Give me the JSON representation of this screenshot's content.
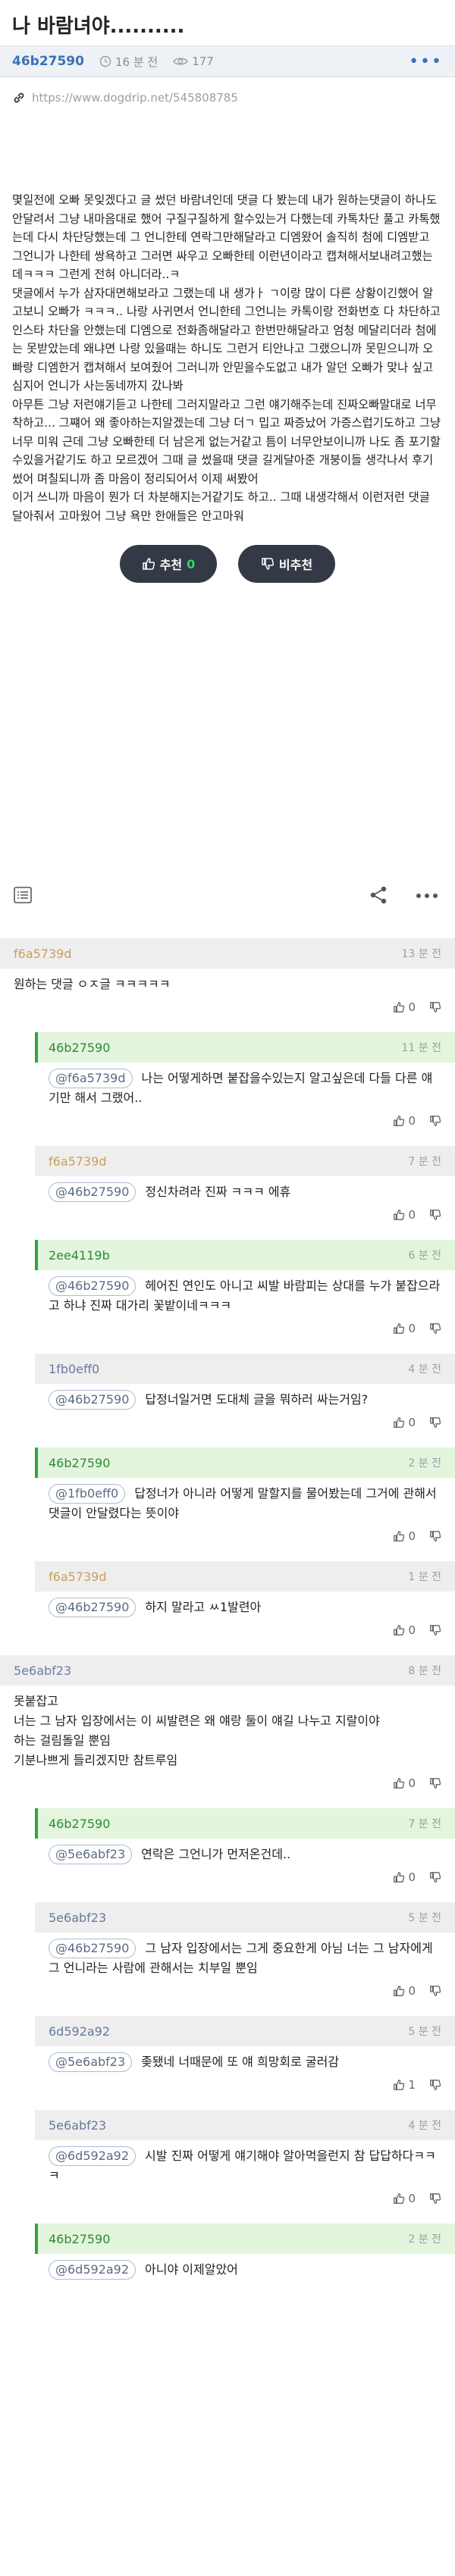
{
  "post": {
    "title": "나 바람녀야..........",
    "author": "46b27590",
    "time": "16 분 전",
    "views": "177",
    "url": "https://www.dogdrip.net/545808785",
    "paragraphs": [
      "몇일전에 오빠 못잊겠다고 글 썼던 바람녀인데 댓글 다 봤는데 내가 원하는댓글이 하나도 안달려서 그냥 내마음대로 했어 구질구질하게 할수있는거 다했는데 카톡차단 풀고 카톡했는데 다시 차단당했는데 그 언니한테 연락그만해달라고 디엠왔어 솔직히 첨에 디엠받고 그언니가 나한테 쌍욕하고 그러면 싸우고 오빠한테 이런년이라고 캡쳐해서보내려고했는데ㅋㅋㅋ 그런게 전혀 아니더라..ㅋ",
      "댓글에서 누가 삼자대면해보라고 그랬는데 내 생가ㅏ ㄱ이랑 많이 다른 상황이긴했어 알고보니 오빠가 ㅋㅋㅋ.. 나랑 사귀면서 언니한테 그언니는 카톡이랑 전화번호 다 차단하고 인스타 차단을 안했는데 디엠으로 전화좀해달라고 한번만해달라고 엄청 메달리더라 첨에는 못받았는데 왜냐면 나랑 있을때는 하니도 그런거 티안나고 그랬으니까 못믿으니까 오빠랑 디엠한거 캡쳐해서 보여줬어 그러니까 안믿을수도없고 내가 알던 오빠가 맞나 싶고",
      "심지어 언니가 사는동네까지 갔나봐",
      "아무튼 그냥 저런얘기듣고 나한테 그러지말라고 그런 얘기해주는데 진짜오빠말대로 너무 착하고... 그쨰어 왜 좋아하는지알겠는데 그냥 더ㄱ 밉고 짜증났어 가증스럽기도하고 그냥 너무 미워 근데 그냥 오빠한테 더 남은게 없는거같고 틈이 너무안보이니까 나도 좀 포기할 수있을거같기도 하고 모르겠어 그때 글 썼을때 댓글 길게달아준 개붕이들 생각나서 후기썼어 며칠되니까 좀 마음이 정리되어서 이제 써봤어",
      "이거 쓰니까 마음이 뭔가 더 차분해지는거같기도 하고.. 그때 내생각해서 이런저런 댓글 달아줘서 고마웠어 그냥 욕만 한애들은 안고마워"
    ],
    "upvote_label": "추천",
    "upvote_count": "0",
    "downvote_label": "비추천"
  },
  "icons": {
    "clock": "clock-icon",
    "eye": "eye-icon",
    "link": "link-icon",
    "list": "list-icon",
    "share": "share-icon",
    "more": "more-icon",
    "thumbs_up": "thumbs-up-icon",
    "thumbs_down": "thumbs-down-icon"
  },
  "comments": [
    {
      "author": "f6a5739d",
      "time": "13 분 전",
      "mention": "",
      "text": "원하는 댓글 ㅇㅈ글 ㅋㅋㅋㅋㅋ",
      "likes": "0",
      "depth": 0,
      "style": "orange"
    },
    {
      "author": "46b27590",
      "time": "11 분 전",
      "mention": "@f6a5739d",
      "text": "나는 어떻게하면 붙잡을수있는지 알고싶은데 다들 다른 얘기만 해서 그랬어..",
      "likes": "0",
      "depth": 1,
      "style": "green"
    },
    {
      "author": "f6a5739d",
      "time": "7 분 전",
      "mention": "@46b27590",
      "text": "정신차려라 진짜 ㅋㅋㅋ 에휴",
      "likes": "0",
      "depth": 1,
      "style": "orange"
    },
    {
      "author": "2ee4119b",
      "time": "6 분 전",
      "mention": "@46b27590",
      "text": "헤어진 연인도 아니고 씨발 바람피는 상대를 누가 붙잡으라고 하냐 진짜 대가리 꽃밭이네ㅋㅋㅋ",
      "likes": "0",
      "depth": 1,
      "style": "green"
    },
    {
      "author": "1fb0eff0",
      "time": "4 분 전",
      "mention": "@46b27590",
      "text": "답정너일거면 도대체 글을 뭐하러 싸는거임?",
      "likes": "0",
      "depth": 1,
      "style": "grey"
    },
    {
      "author": "46b27590",
      "time": "2 분 전",
      "mention": "@1fb0eff0",
      "text": "답정너가 아니라 어떻게 말할지를 물어봤는데 그거에 관해서 댓글이 안달렸다는 뜻이야",
      "likes": "0",
      "depth": 1,
      "style": "green"
    },
    {
      "author": "f6a5739d",
      "time": "1 분 전",
      "mention": "@46b27590",
      "text": "하지 말라고 ㅆ1발련아",
      "likes": "0",
      "depth": 1,
      "style": "orange"
    },
    {
      "author": "5e6abf23",
      "time": "8 분 전",
      "mention": "",
      "text": "못붙잡고\n너는 그 남자 입장에서는 이 씨발련은 왜 얘랑 둘이 얘길 나누고 지랄이야\n하는 걸림돌일 뿐임\n기분나쁘게 들리겠지만 참트루임",
      "likes": "0",
      "depth": 0,
      "style": "grey"
    },
    {
      "author": "46b27590",
      "time": "7 분 전",
      "mention": "@5e6abf23",
      "text": "연락은 그언니가 먼저온건데..",
      "likes": "0",
      "depth": 1,
      "style": "green"
    },
    {
      "author": "5e6abf23",
      "time": "5 분 전",
      "mention": "@46b27590",
      "text": "그 남자 입장에서는 그게 중요한게 아님 너는 그 남자에게 그 언니라는 사람에 관해서는 치부일 뿐임",
      "likes": "0",
      "depth": 1,
      "style": "grey"
    },
    {
      "author": "6d592a92",
      "time": "5 분 전",
      "mention": "@5e6abf23",
      "text": "좆됐네 너때문에 또 얘 희망회로 굴러감",
      "likes": "1",
      "depth": 1,
      "style": "grey"
    },
    {
      "author": "5e6abf23",
      "time": "4 분 전",
      "mention": "@6d592a92",
      "text": "시발 진짜 어떻게 얘기해야 알아먹을런지 참 답답하다ㅋㅋㅋ",
      "likes": "0",
      "depth": 1,
      "style": "grey"
    },
    {
      "author": "46b27590",
      "time": "2 분 전",
      "mention": "@6d592a92",
      "text": "아니야 이제알았어",
      "likes": "",
      "depth": 1,
      "style": "green"
    }
  ]
}
